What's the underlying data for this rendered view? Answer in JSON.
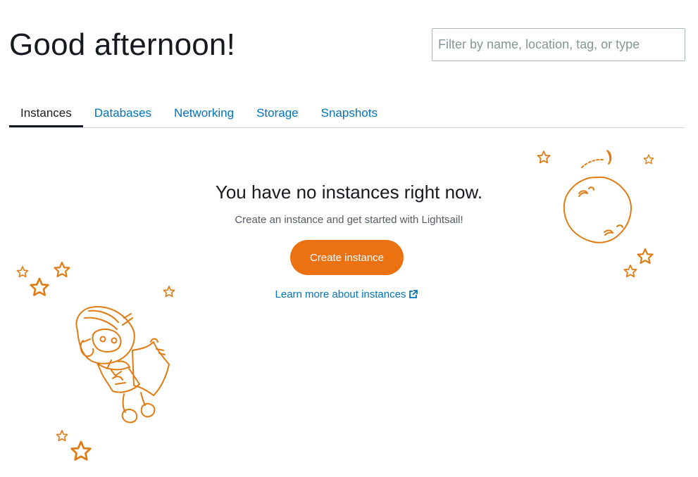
{
  "header": {
    "greeting": "Good afternoon!",
    "filter_placeholder": "Filter by name, location, tag, or type"
  },
  "tabs": [
    {
      "label": "Instances",
      "active": true
    },
    {
      "label": "Databases",
      "active": false
    },
    {
      "label": "Networking",
      "active": false
    },
    {
      "label": "Storage",
      "active": false
    },
    {
      "label": "Snapshots",
      "active": false
    }
  ],
  "empty_state": {
    "title": "You have no instances right now.",
    "subtitle": "Create an instance and get started with Lightsail!",
    "create_button": "Create instance",
    "learn_link": "Learn more about instances"
  },
  "icons": {
    "external_link": "external-link-icon",
    "illustration": [
      "robot-astronaut-illustration",
      "moon-illustration",
      "star-icon"
    ]
  },
  "colors": {
    "accent": "#ec7211",
    "link": "#0073bb",
    "text": "#16191f",
    "illustration": "#e07b13"
  }
}
